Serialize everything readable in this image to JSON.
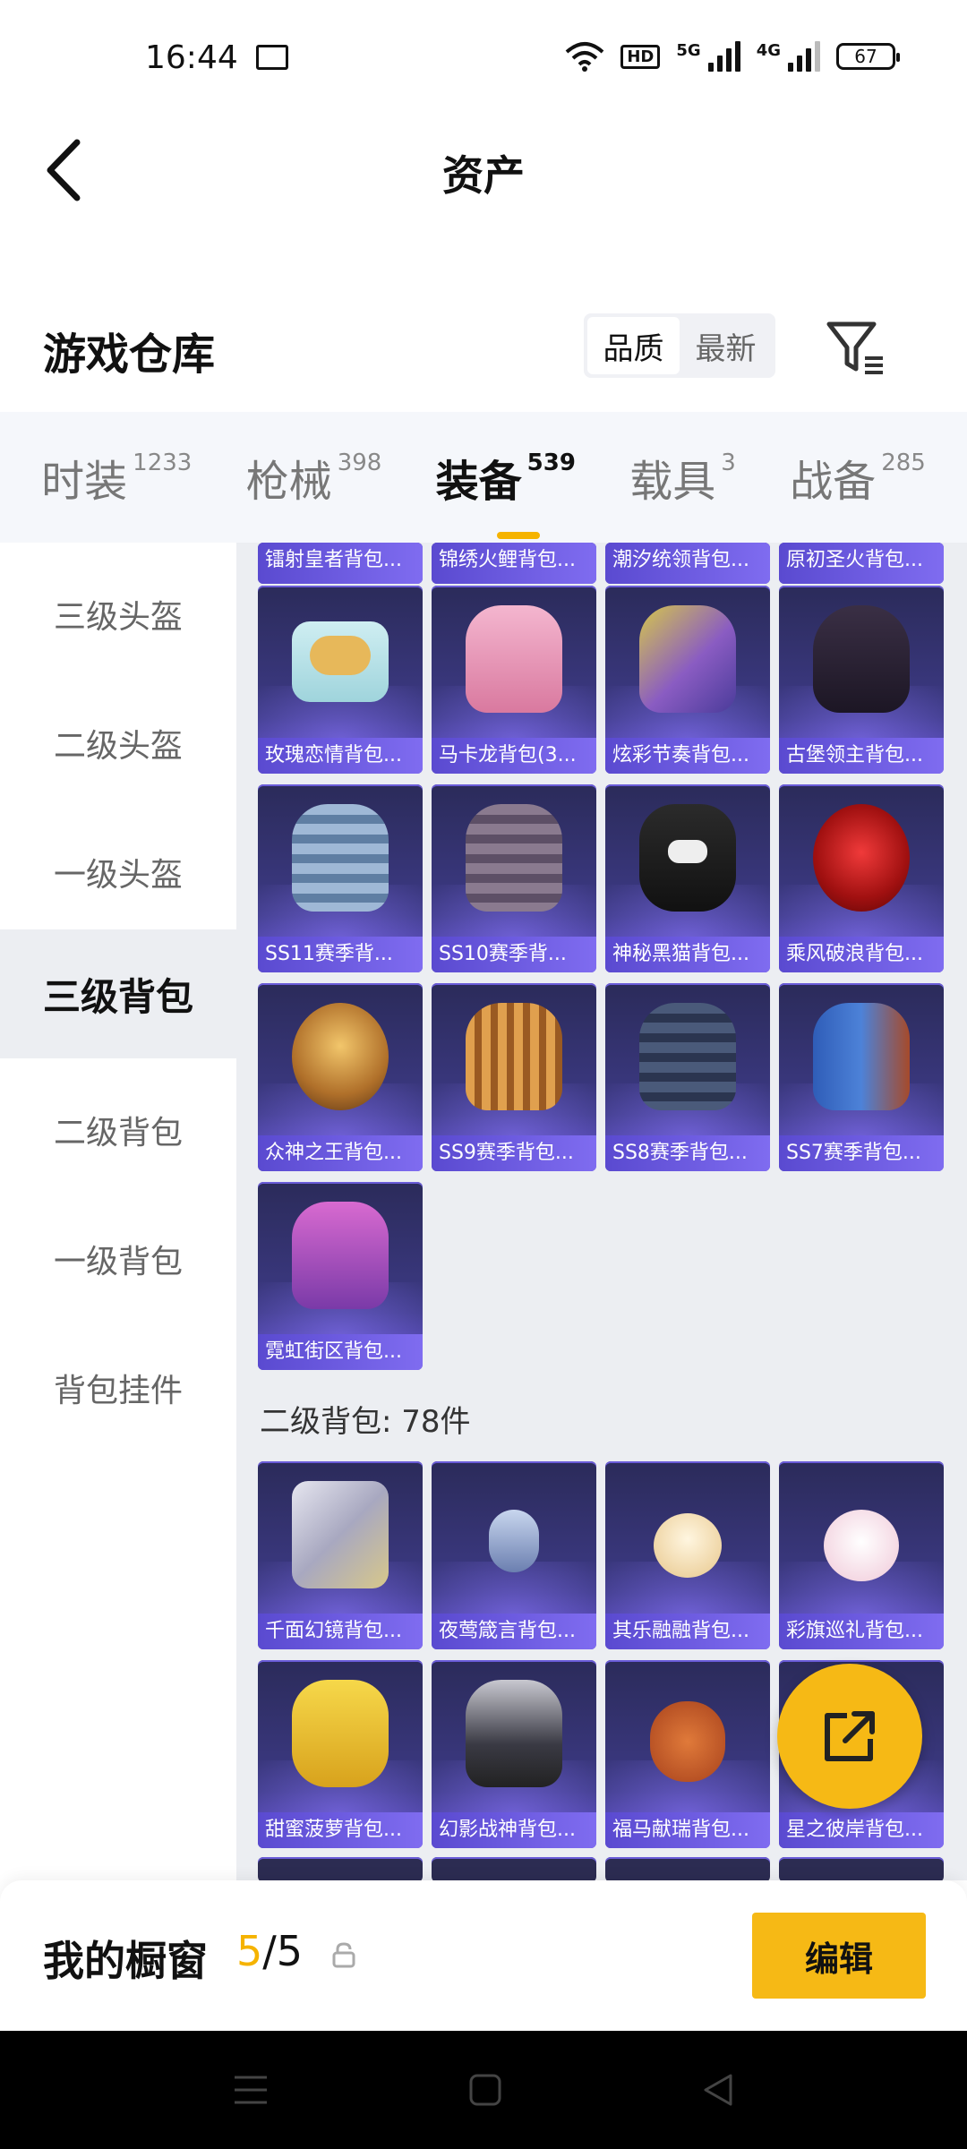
{
  "status_bar": {
    "time": "16:44",
    "net_5g": "5G",
    "net_4g": "4G",
    "hd": "HD",
    "battery": "67"
  },
  "header": {
    "title": "资产"
  },
  "warehouse": {
    "title": "游戏仓库",
    "sort_options": [
      "品质",
      "最新"
    ],
    "active_sort": "品质"
  },
  "tabs": [
    {
      "label": "时装",
      "count": "1233"
    },
    {
      "label": "枪械",
      "count": "398"
    },
    {
      "label": "装备",
      "count": "539",
      "active": true
    },
    {
      "label": "载具",
      "count": "3"
    },
    {
      "label": "战备",
      "count": "285"
    }
  ],
  "sidenav": [
    {
      "label": "三级头盔"
    },
    {
      "label": "二级头盔"
    },
    {
      "label": "一级头盔"
    },
    {
      "label": "三级背包",
      "active": true
    },
    {
      "label": "二级背包"
    },
    {
      "label": "一级背包"
    },
    {
      "label": "背包挂件"
    }
  ],
  "items": {
    "top_partial": [
      "镭射皇者背包...",
      "锦绣火鲤背包...",
      "潮汐统领背包...",
      "原初圣火背包..."
    ],
    "row1": [
      "玫瑰恋情背包...",
      "马卡龙背包(3...",
      "炫彩节奏背包...",
      "古堡领主背包..."
    ],
    "row2": [
      "SS11赛季背...",
      "SS10赛季背...",
      "神秘黑猫背包...",
      "乘风破浪背包..."
    ],
    "row3": [
      "众神之王背包...",
      "SS9赛季背包...",
      "SS8赛季背包...",
      "SS7赛季背包..."
    ],
    "row4": [
      "霓虹街区背包..."
    ],
    "level2_heading": "二级背包: 78件",
    "row5": [
      "千面幻镜背包...",
      "夜莺箴言背包...",
      "其乐融融背包...",
      "彩旗巡礼背包..."
    ],
    "row6": [
      "甜蜜菠萝背包...",
      "幻影战神背包...",
      "福马献瑞背包...",
      "星之彼岸背包..."
    ]
  },
  "showcase": {
    "label": "我的橱窗",
    "current": "5",
    "total": "/5",
    "edit_label": "编辑"
  },
  "colors": {
    "accent": "#f6b915",
    "card_bg": "#3d3a86",
    "card_label": "#6a5ae0"
  }
}
